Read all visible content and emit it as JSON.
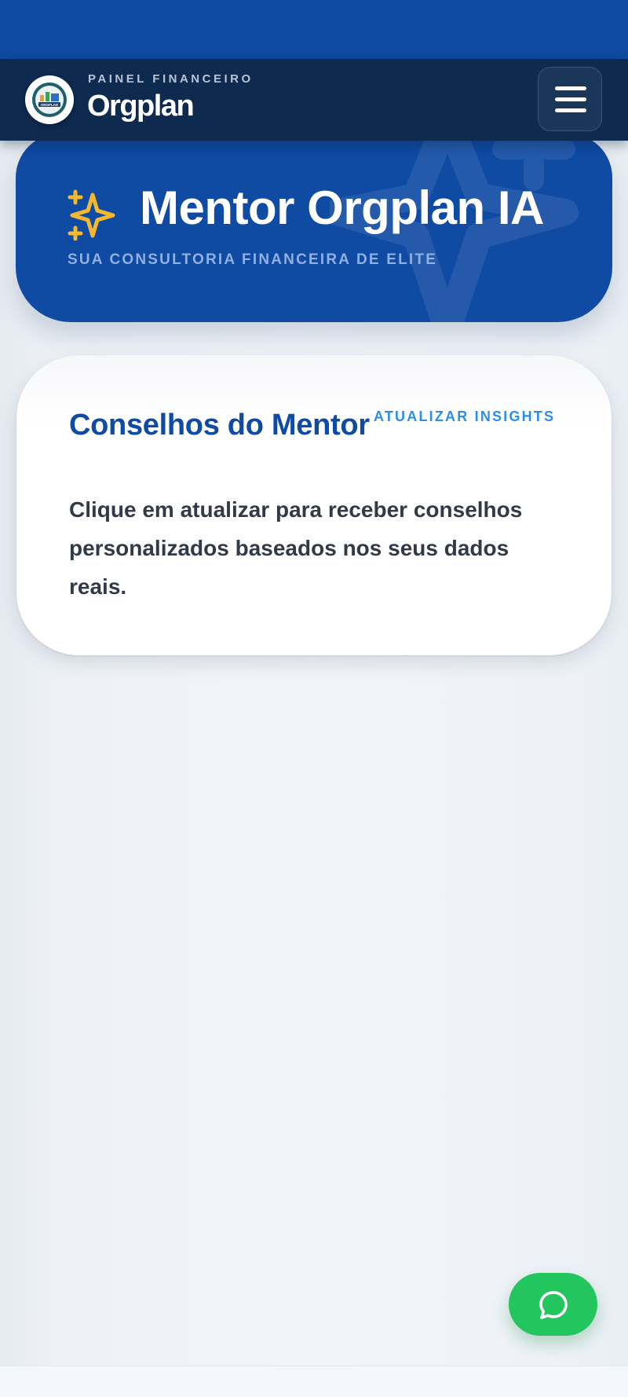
{
  "header": {
    "kicker": "PAINEL FINANCEIRO",
    "title": "Orgplan",
    "logo_text": "ORGPLAN",
    "menu_icon": "hamburger-menu-icon"
  },
  "hero": {
    "title": "Mentor Orgplan IA",
    "subtitle": "SUA CONSULTORIA FINANCEIRA DE ELITE",
    "icon": "sparkles-icon"
  },
  "mentor_card": {
    "title": "Conselhos do Mentor",
    "refresh_label": "ATUALIZAR INSIGHTS",
    "body": "Clique em atualizar para receber conselhos personalizados baseados nos seus dados reais."
  },
  "floating_action": {
    "icon": "chat-bubble-icon"
  },
  "colors": {
    "primary": "#0f4aa3",
    "header_bg": "#0e2a4f",
    "accent_gold": "#f5b82e",
    "link": "#2b8ee8",
    "whatsapp": "#22c55e"
  }
}
